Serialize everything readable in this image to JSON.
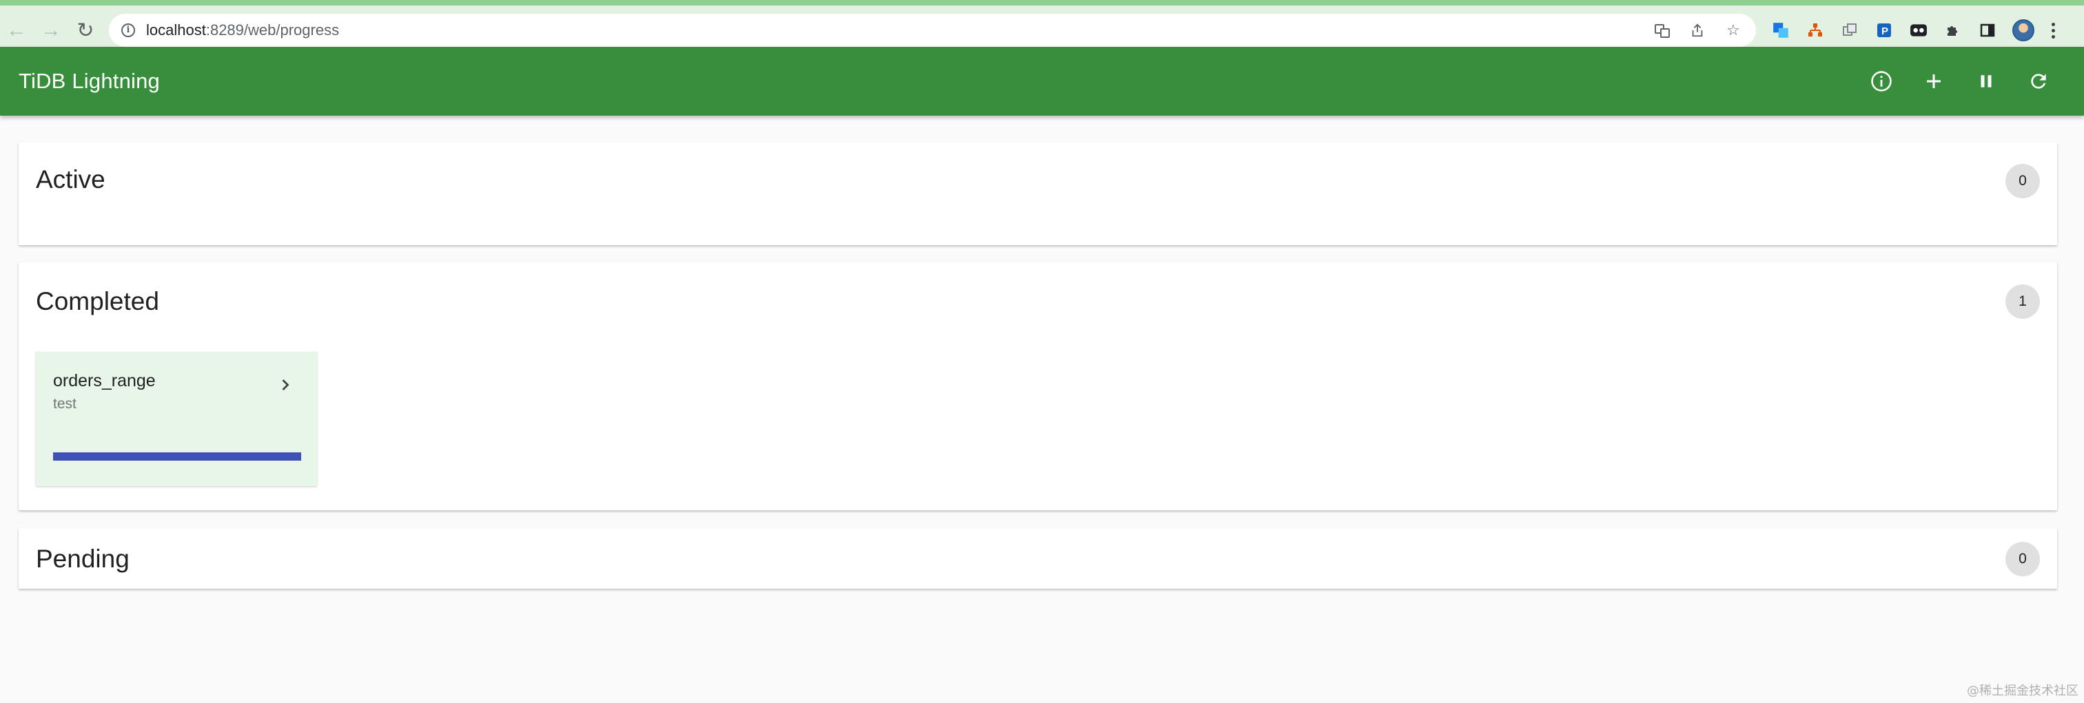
{
  "browser": {
    "url_host": "localhost",
    "url_path": ":8289/web/progress"
  },
  "app": {
    "title": "TiDB Lightning",
    "actions": [
      {
        "name": "info-icon"
      },
      {
        "name": "add-icon"
      },
      {
        "name": "pause-icon"
      },
      {
        "name": "refresh-icon"
      }
    ]
  },
  "sections": {
    "active": {
      "title": "Active",
      "count": "0"
    },
    "completed": {
      "title": "Completed",
      "count": "1",
      "tasks": [
        {
          "table": "orders_range",
          "database": "test",
          "progress": 1.0
        }
      ]
    },
    "pending": {
      "title": "Pending",
      "count": "0"
    }
  },
  "watermark": "@稀土掘金技术社区",
  "colors": {
    "appbar": "#388e3c",
    "card": "#e8f5e9",
    "progress": "#3f51b5"
  }
}
